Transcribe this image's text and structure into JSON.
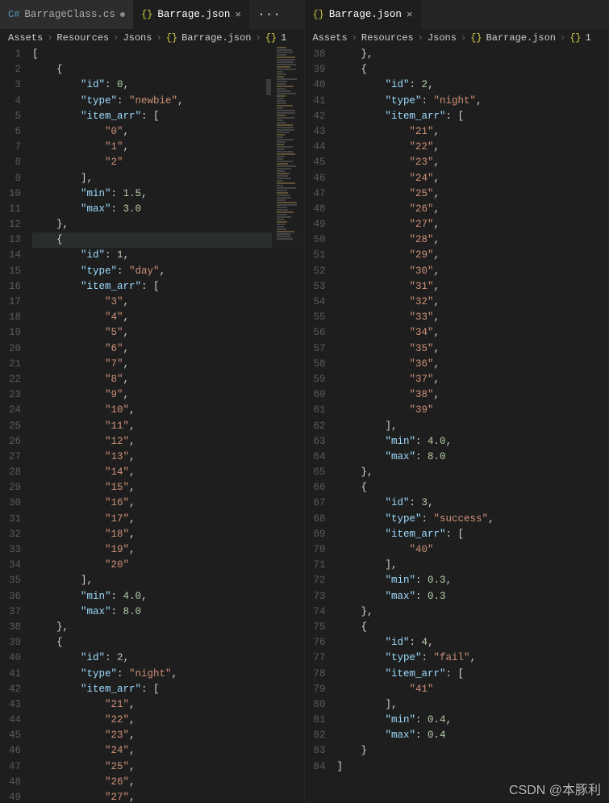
{
  "leftPane": {
    "tabs": [
      {
        "icon": "cs",
        "label": "BarrageClass.cs",
        "active": false,
        "dirty": true
      },
      {
        "icon": "json",
        "label": "Barrage.json",
        "active": true,
        "dirty": false
      }
    ],
    "overflow": "···",
    "breadcrumb": [
      "Assets",
      "Resources",
      "Jsons",
      "Barrage.json",
      "1"
    ],
    "breadcrumb_icons": {
      "file": "{}",
      "obj": "{}"
    },
    "startLine": 1,
    "highlightedLine": 13,
    "tokens": [
      [
        [
          "p",
          "["
        ]
      ],
      [
        [
          "p",
          "    {"
        ]
      ],
      [
        [
          "p",
          "        "
        ],
        [
          "k",
          "\"id\""
        ],
        [
          "p",
          ": "
        ],
        [
          "n",
          "0"
        ],
        [
          "p",
          ","
        ]
      ],
      [
        [
          "p",
          "        "
        ],
        [
          "k",
          "\"type\""
        ],
        [
          "p",
          ": "
        ],
        [
          "s",
          "\"newbie\""
        ],
        [
          "p",
          ","
        ]
      ],
      [
        [
          "p",
          "        "
        ],
        [
          "k",
          "\"item_arr\""
        ],
        [
          "p",
          ": ["
        ]
      ],
      [
        [
          "p",
          "            "
        ],
        [
          "s",
          "\"0\""
        ],
        [
          "p",
          ","
        ]
      ],
      [
        [
          "p",
          "            "
        ],
        [
          "s",
          "\"1\""
        ],
        [
          "p",
          ","
        ]
      ],
      [
        [
          "p",
          "            "
        ],
        [
          "s",
          "\"2\""
        ]
      ],
      [
        [
          "p",
          "        ],"
        ]
      ],
      [
        [
          "p",
          "        "
        ],
        [
          "k",
          "\"min\""
        ],
        [
          "p",
          ": "
        ],
        [
          "n",
          "1.5"
        ],
        [
          "p",
          ","
        ]
      ],
      [
        [
          "p",
          "        "
        ],
        [
          "k",
          "\"max\""
        ],
        [
          "p",
          ": "
        ],
        [
          "n",
          "3.0"
        ]
      ],
      [
        [
          "p",
          "    },"
        ]
      ],
      [
        [
          "p",
          "    {"
        ]
      ],
      [
        [
          "p",
          "        "
        ],
        [
          "k",
          "\"id\""
        ],
        [
          "p",
          ": "
        ],
        [
          "n",
          "1"
        ],
        [
          "p",
          ","
        ]
      ],
      [
        [
          "p",
          "        "
        ],
        [
          "k",
          "\"type\""
        ],
        [
          "p",
          ": "
        ],
        [
          "s",
          "\"day\""
        ],
        [
          "p",
          ","
        ]
      ],
      [
        [
          "p",
          "        "
        ],
        [
          "k",
          "\"item_arr\""
        ],
        [
          "p",
          ": ["
        ]
      ],
      [
        [
          "p",
          "            "
        ],
        [
          "s",
          "\"3\""
        ],
        [
          "p",
          ","
        ]
      ],
      [
        [
          "p",
          "            "
        ],
        [
          "s",
          "\"4\""
        ],
        [
          "p",
          ","
        ]
      ],
      [
        [
          "p",
          "            "
        ],
        [
          "s",
          "\"5\""
        ],
        [
          "p",
          ","
        ]
      ],
      [
        [
          "p",
          "            "
        ],
        [
          "s",
          "\"6\""
        ],
        [
          "p",
          ","
        ]
      ],
      [
        [
          "p",
          "            "
        ],
        [
          "s",
          "\"7\""
        ],
        [
          "p",
          ","
        ]
      ],
      [
        [
          "p",
          "            "
        ],
        [
          "s",
          "\"8\""
        ],
        [
          "p",
          ","
        ]
      ],
      [
        [
          "p",
          "            "
        ],
        [
          "s",
          "\"9\""
        ],
        [
          "p",
          ","
        ]
      ],
      [
        [
          "p",
          "            "
        ],
        [
          "s",
          "\"10\""
        ],
        [
          "p",
          ","
        ]
      ],
      [
        [
          "p",
          "            "
        ],
        [
          "s",
          "\"11\""
        ],
        [
          "p",
          ","
        ]
      ],
      [
        [
          "p",
          "            "
        ],
        [
          "s",
          "\"12\""
        ],
        [
          "p",
          ","
        ]
      ],
      [
        [
          "p",
          "            "
        ],
        [
          "s",
          "\"13\""
        ],
        [
          "p",
          ","
        ]
      ],
      [
        [
          "p",
          "            "
        ],
        [
          "s",
          "\"14\""
        ],
        [
          "p",
          ","
        ]
      ],
      [
        [
          "p",
          "            "
        ],
        [
          "s",
          "\"15\""
        ],
        [
          "p",
          ","
        ]
      ],
      [
        [
          "p",
          "            "
        ],
        [
          "s",
          "\"16\""
        ],
        [
          "p",
          ","
        ]
      ],
      [
        [
          "p",
          "            "
        ],
        [
          "s",
          "\"17\""
        ],
        [
          "p",
          ","
        ]
      ],
      [
        [
          "p",
          "            "
        ],
        [
          "s",
          "\"18\""
        ],
        [
          "p",
          ","
        ]
      ],
      [
        [
          "p",
          "            "
        ],
        [
          "s",
          "\"19\""
        ],
        [
          "p",
          ","
        ]
      ],
      [
        [
          "p",
          "            "
        ],
        [
          "s",
          "\"20\""
        ]
      ],
      [
        [
          "p",
          "        ],"
        ]
      ],
      [
        [
          "p",
          "        "
        ],
        [
          "k",
          "\"min\""
        ],
        [
          "p",
          ": "
        ],
        [
          "n",
          "4.0"
        ],
        [
          "p",
          ","
        ]
      ],
      [
        [
          "p",
          "        "
        ],
        [
          "k",
          "\"max\""
        ],
        [
          "p",
          ": "
        ],
        [
          "n",
          "8.0"
        ]
      ],
      [
        [
          "p",
          "    },"
        ]
      ],
      [
        [
          "p",
          "    {"
        ]
      ],
      [
        [
          "p",
          "        "
        ],
        [
          "k",
          "\"id\""
        ],
        [
          "p",
          ": "
        ],
        [
          "n",
          "2"
        ],
        [
          "p",
          ","
        ]
      ],
      [
        [
          "p",
          "        "
        ],
        [
          "k",
          "\"type\""
        ],
        [
          "p",
          ": "
        ],
        [
          "s",
          "\"night\""
        ],
        [
          "p",
          ","
        ]
      ],
      [
        [
          "p",
          "        "
        ],
        [
          "k",
          "\"item_arr\""
        ],
        [
          "p",
          ": ["
        ]
      ],
      [
        [
          "p",
          "            "
        ],
        [
          "s",
          "\"21\""
        ],
        [
          "p",
          ","
        ]
      ],
      [
        [
          "p",
          "            "
        ],
        [
          "s",
          "\"22\""
        ],
        [
          "p",
          ","
        ]
      ],
      [
        [
          "p",
          "            "
        ],
        [
          "s",
          "\"23\""
        ],
        [
          "p",
          ","
        ]
      ],
      [
        [
          "p",
          "            "
        ],
        [
          "s",
          "\"24\""
        ],
        [
          "p",
          ","
        ]
      ],
      [
        [
          "p",
          "            "
        ],
        [
          "s",
          "\"25\""
        ],
        [
          "p",
          ","
        ]
      ],
      [
        [
          "p",
          "            "
        ],
        [
          "s",
          "\"26\""
        ],
        [
          "p",
          ","
        ]
      ],
      [
        [
          "p",
          "            "
        ],
        [
          "s",
          "\"27\""
        ],
        [
          "p",
          ","
        ]
      ]
    ]
  },
  "rightPane": {
    "tabs": [
      {
        "icon": "json",
        "label": "Barrage.json",
        "active": true,
        "dirty": false
      }
    ],
    "breadcrumb": [
      "Assets",
      "Resources",
      "Jsons",
      "Barrage.json",
      "1"
    ],
    "startLine": 38,
    "highlightedLine": null,
    "tokens": [
      [
        [
          "p",
          "    },"
        ]
      ],
      [
        [
          "p",
          "    {"
        ]
      ],
      [
        [
          "p",
          "        "
        ],
        [
          "k",
          "\"id\""
        ],
        [
          "p",
          ": "
        ],
        [
          "n",
          "2"
        ],
        [
          "p",
          ","
        ]
      ],
      [
        [
          "p",
          "        "
        ],
        [
          "k",
          "\"type\""
        ],
        [
          "p",
          ": "
        ],
        [
          "s",
          "\"night\""
        ],
        [
          "p",
          ","
        ]
      ],
      [
        [
          "p",
          "        "
        ],
        [
          "k",
          "\"item_arr\""
        ],
        [
          "p",
          ": ["
        ]
      ],
      [
        [
          "p",
          "            "
        ],
        [
          "s",
          "\"21\""
        ],
        [
          "p",
          ","
        ]
      ],
      [
        [
          "p",
          "            "
        ],
        [
          "s",
          "\"22\""
        ],
        [
          "p",
          ","
        ]
      ],
      [
        [
          "p",
          "            "
        ],
        [
          "s",
          "\"23\""
        ],
        [
          "p",
          ","
        ]
      ],
      [
        [
          "p",
          "            "
        ],
        [
          "s",
          "\"24\""
        ],
        [
          "p",
          ","
        ]
      ],
      [
        [
          "p",
          "            "
        ],
        [
          "s",
          "\"25\""
        ],
        [
          "p",
          ","
        ]
      ],
      [
        [
          "p",
          "            "
        ],
        [
          "s",
          "\"26\""
        ],
        [
          "p",
          ","
        ]
      ],
      [
        [
          "p",
          "            "
        ],
        [
          "s",
          "\"27\""
        ],
        [
          "p",
          ","
        ]
      ],
      [
        [
          "p",
          "            "
        ],
        [
          "s",
          "\"28\""
        ],
        [
          "p",
          ","
        ]
      ],
      [
        [
          "p",
          "            "
        ],
        [
          "s",
          "\"29\""
        ],
        [
          "p",
          ","
        ]
      ],
      [
        [
          "p",
          "            "
        ],
        [
          "s",
          "\"30\""
        ],
        [
          "p",
          ","
        ]
      ],
      [
        [
          "p",
          "            "
        ],
        [
          "s",
          "\"31\""
        ],
        [
          "p",
          ","
        ]
      ],
      [
        [
          "p",
          "            "
        ],
        [
          "s",
          "\"32\""
        ],
        [
          "p",
          ","
        ]
      ],
      [
        [
          "p",
          "            "
        ],
        [
          "s",
          "\"33\""
        ],
        [
          "p",
          ","
        ]
      ],
      [
        [
          "p",
          "            "
        ],
        [
          "s",
          "\"34\""
        ],
        [
          "p",
          ","
        ]
      ],
      [
        [
          "p",
          "            "
        ],
        [
          "s",
          "\"35\""
        ],
        [
          "p",
          ","
        ]
      ],
      [
        [
          "p",
          "            "
        ],
        [
          "s",
          "\"36\""
        ],
        [
          "p",
          ","
        ]
      ],
      [
        [
          "p",
          "            "
        ],
        [
          "s",
          "\"37\""
        ],
        [
          "p",
          ","
        ]
      ],
      [
        [
          "p",
          "            "
        ],
        [
          "s",
          "\"38\""
        ],
        [
          "p",
          ","
        ]
      ],
      [
        [
          "p",
          "            "
        ],
        [
          "s",
          "\"39\""
        ]
      ],
      [
        [
          "p",
          "        ],"
        ]
      ],
      [
        [
          "p",
          "        "
        ],
        [
          "k",
          "\"min\""
        ],
        [
          "p",
          ": "
        ],
        [
          "n",
          "4.0"
        ],
        [
          "p",
          ","
        ]
      ],
      [
        [
          "p",
          "        "
        ],
        [
          "k",
          "\"max\""
        ],
        [
          "p",
          ": "
        ],
        [
          "n",
          "8.0"
        ]
      ],
      [
        [
          "p",
          "    },"
        ]
      ],
      [
        [
          "p",
          "    {"
        ]
      ],
      [
        [
          "p",
          "        "
        ],
        [
          "k",
          "\"id\""
        ],
        [
          "p",
          ": "
        ],
        [
          "n",
          "3"
        ],
        [
          "p",
          ","
        ]
      ],
      [
        [
          "p",
          "        "
        ],
        [
          "k",
          "\"type\""
        ],
        [
          "p",
          ": "
        ],
        [
          "s",
          "\"success\""
        ],
        [
          "p",
          ","
        ]
      ],
      [
        [
          "p",
          "        "
        ],
        [
          "k",
          "\"item_arr\""
        ],
        [
          "p",
          ": ["
        ]
      ],
      [
        [
          "p",
          "            "
        ],
        [
          "s",
          "\"40\""
        ]
      ],
      [
        [
          "p",
          "        ],"
        ]
      ],
      [
        [
          "p",
          "        "
        ],
        [
          "k",
          "\"min\""
        ],
        [
          "p",
          ": "
        ],
        [
          "n",
          "0.3"
        ],
        [
          "p",
          ","
        ]
      ],
      [
        [
          "p",
          "        "
        ],
        [
          "k",
          "\"max\""
        ],
        [
          "p",
          ": "
        ],
        [
          "n",
          "0.3"
        ]
      ],
      [
        [
          "p",
          "    },"
        ]
      ],
      [
        [
          "p",
          "    {"
        ]
      ],
      [
        [
          "p",
          "        "
        ],
        [
          "k",
          "\"id\""
        ],
        [
          "p",
          ": "
        ],
        [
          "n",
          "4"
        ],
        [
          "p",
          ","
        ]
      ],
      [
        [
          "p",
          "        "
        ],
        [
          "k",
          "\"type\""
        ],
        [
          "p",
          ": "
        ],
        [
          "s",
          "\"fail\""
        ],
        [
          "p",
          ","
        ]
      ],
      [
        [
          "p",
          "        "
        ],
        [
          "k",
          "\"item_arr\""
        ],
        [
          "p",
          ": ["
        ]
      ],
      [
        [
          "p",
          "            "
        ],
        [
          "s",
          "\"41\""
        ]
      ],
      [
        [
          "p",
          "        ],"
        ]
      ],
      [
        [
          "p",
          "        "
        ],
        [
          "k",
          "\"min\""
        ],
        [
          "p",
          ": "
        ],
        [
          "n",
          "0.4"
        ],
        [
          "p",
          ","
        ]
      ],
      [
        [
          "p",
          "        "
        ],
        [
          "k",
          "\"max\""
        ],
        [
          "p",
          ": "
        ],
        [
          "n",
          "0.4"
        ]
      ],
      [
        [
          "p",
          "    }"
        ]
      ],
      [
        [
          "p",
          "]"
        ]
      ]
    ]
  },
  "watermark": "CSDN @本豚利"
}
